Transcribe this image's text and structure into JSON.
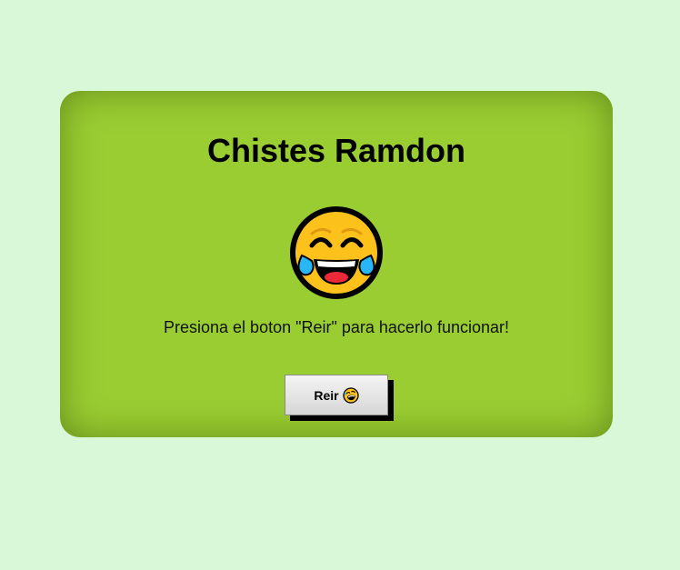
{
  "card": {
    "title": "Chistes Ramdon",
    "emoji_icon": "face-with-tears-of-joy-icon",
    "instructions": "Presiona el boton \"Reir\" para hacerlo funcionar!",
    "button": {
      "label": "Reir",
      "icon": "rolling-on-the-floor-laughing-icon"
    }
  },
  "colors": {
    "background": "#d9f8d7",
    "card": "#9acd32",
    "emoji_face": "#fcc21b",
    "tears": "#29b6f6"
  }
}
